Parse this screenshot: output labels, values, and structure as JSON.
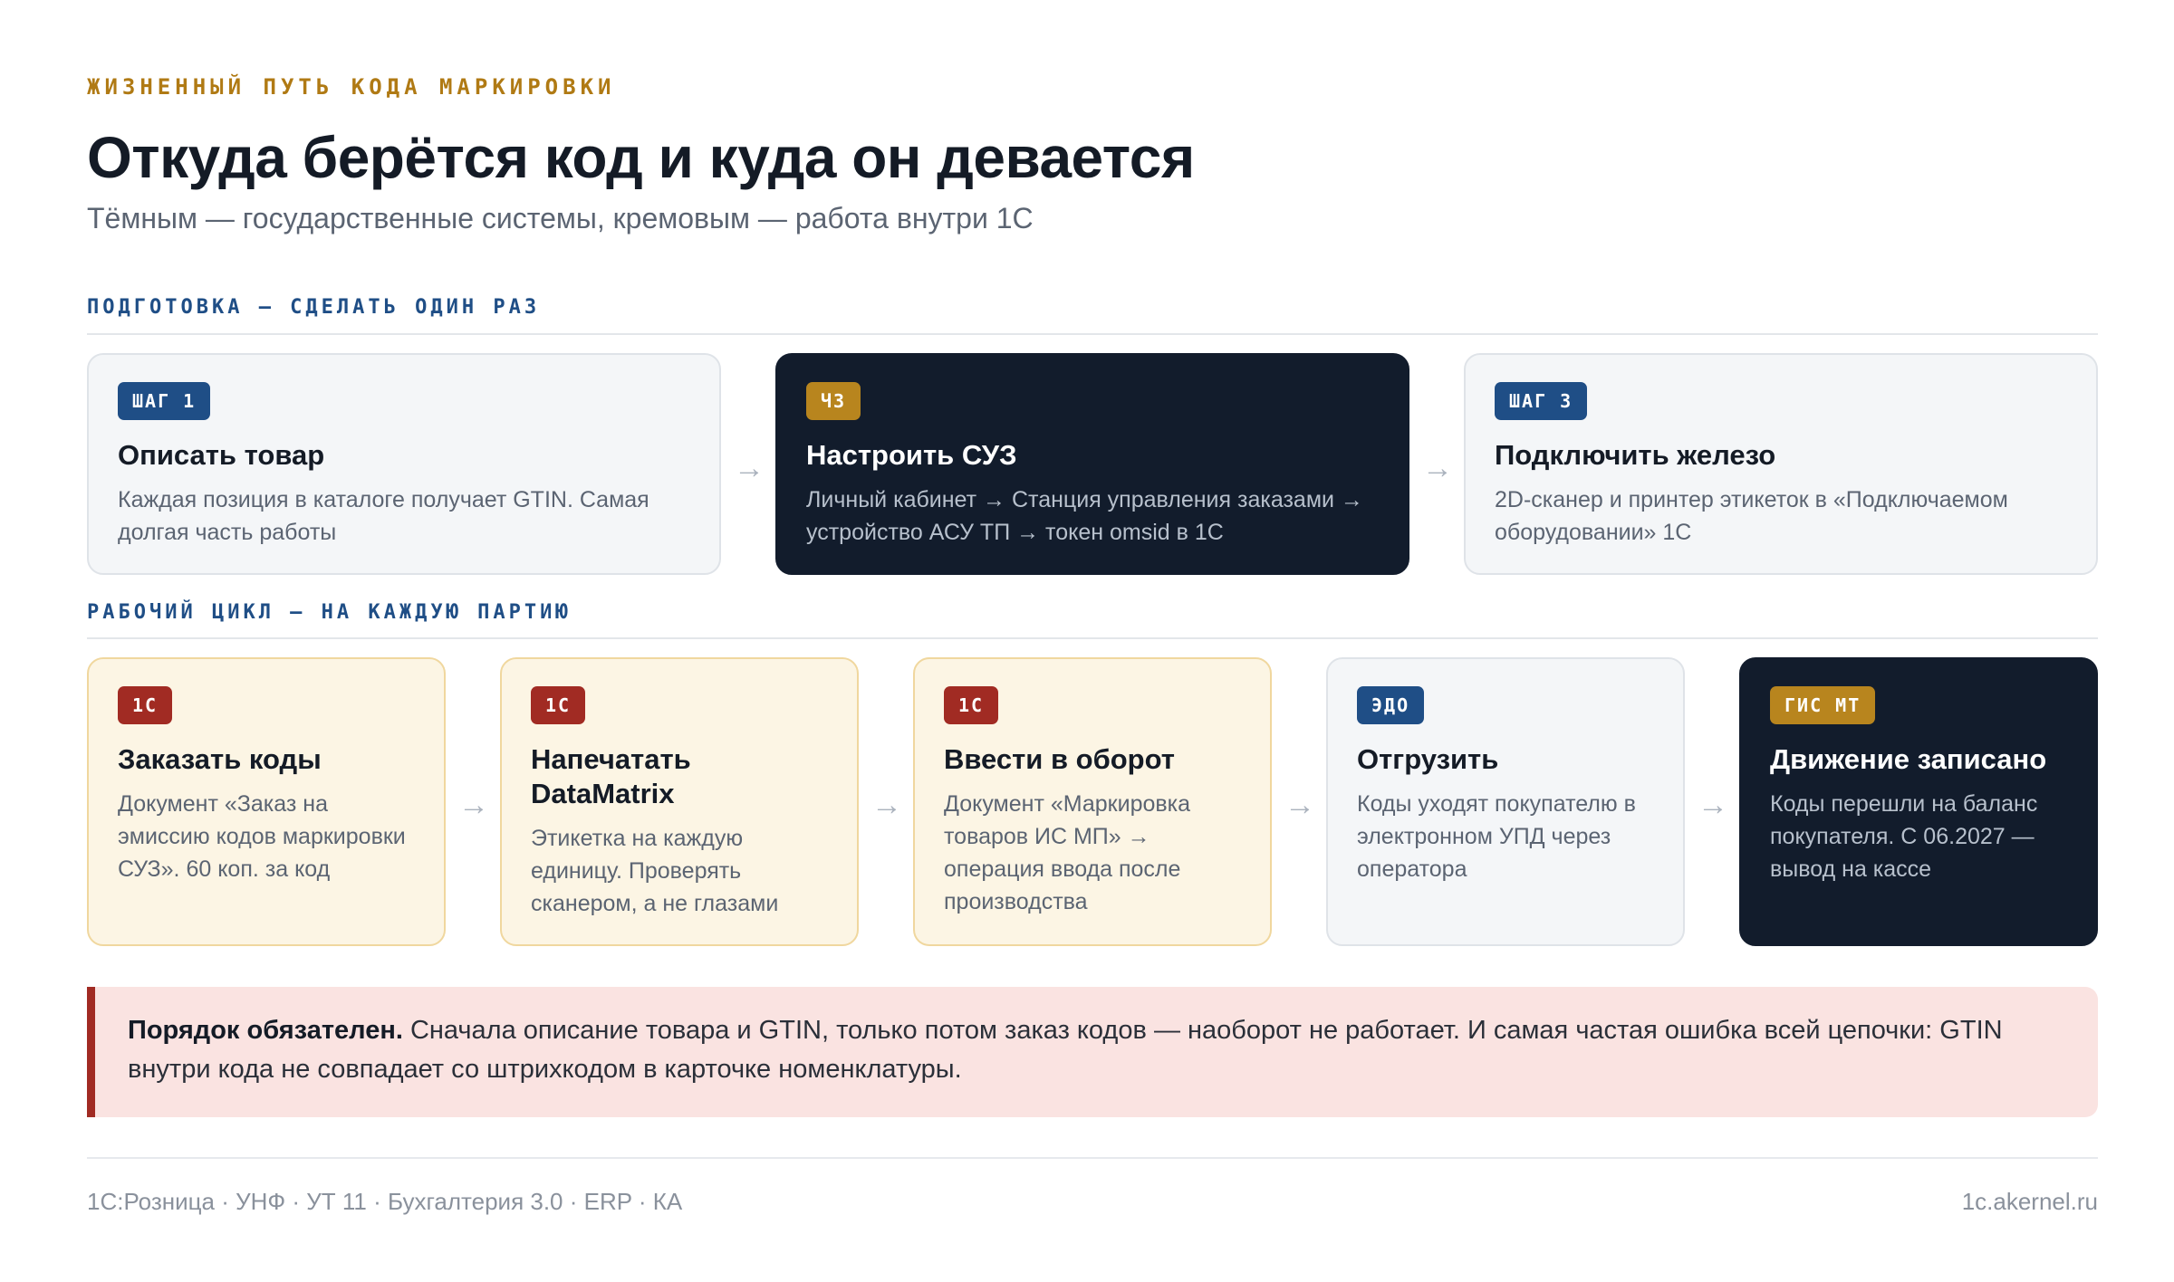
{
  "header": {
    "eyebrow": "ЖИЗНЕННЫЙ ПУТЬ КОДА МАРКИРОВКИ",
    "title": "Откуда берётся код и куда он девается",
    "subtitle": "Тёмным — государственные системы, кремовым — работа внутри 1С"
  },
  "preparation": {
    "label": "ПОДГОТОВКА — СДЕЛАТЬ ОДИН РАЗ",
    "cards": [
      {
        "badge": "ШАГ 1",
        "title": "Описать товар",
        "text": "Каждая позиция в каталоге получает GTIN. Самая долгая часть работы"
      },
      {
        "badge": "ЧЗ",
        "title": "Настроить СУЗ",
        "text": "Личный кабинет → Станция управления заказами → устройство АСУ ТП → токен omsid в 1С"
      },
      {
        "badge": "ШАГ 3",
        "title": "Подключить железо",
        "text": "2D-сканер и принтер этикеток в «Подключаемом оборудовании» 1С"
      }
    ]
  },
  "cycle": {
    "label": "РАБОЧИЙ ЦИКЛ — НА КАЖДУЮ ПАРТИЮ",
    "cards": [
      {
        "badge": "1С",
        "title": "Заказать коды",
        "text": "Документ «Заказ на эмиссию кодов маркировки СУЗ». 60 коп. за код"
      },
      {
        "badge": "1С",
        "title": "Напечатать DataMatrix",
        "text": "Этикетка на каждую единицу. Проверять сканером, а не глазами"
      },
      {
        "badge": "1С",
        "title": "Ввести в оборот",
        "text": "Документ «Маркировка товаров ИС МП» → операция ввода после производства"
      },
      {
        "badge": "ЭДО",
        "title": "Отгрузить",
        "text": "Коды уходят покупателю в электронном УПД через оператора"
      },
      {
        "badge": "ГИС МТ",
        "title": "Движение записано",
        "text": "Коды перешли на баланс покупателя. С 06.2027 — вывод на кассе"
      }
    ]
  },
  "arrow": "→",
  "callout": {
    "bold": "Порядок обязателен.",
    "text": " Сначала описание товара и GTIN, только потом заказ кодов — наоборот не работает. И самая частая ошибка всей цепочки: GTIN внутри кода не совпадает со штрихкодом в карточке номенклатуры."
  },
  "footer": {
    "products": "1С:Розница · УНФ · УТ 11 · Бухгалтерия 3.0 · ERP · КА",
    "site": "1c.akernel.ru"
  }
}
